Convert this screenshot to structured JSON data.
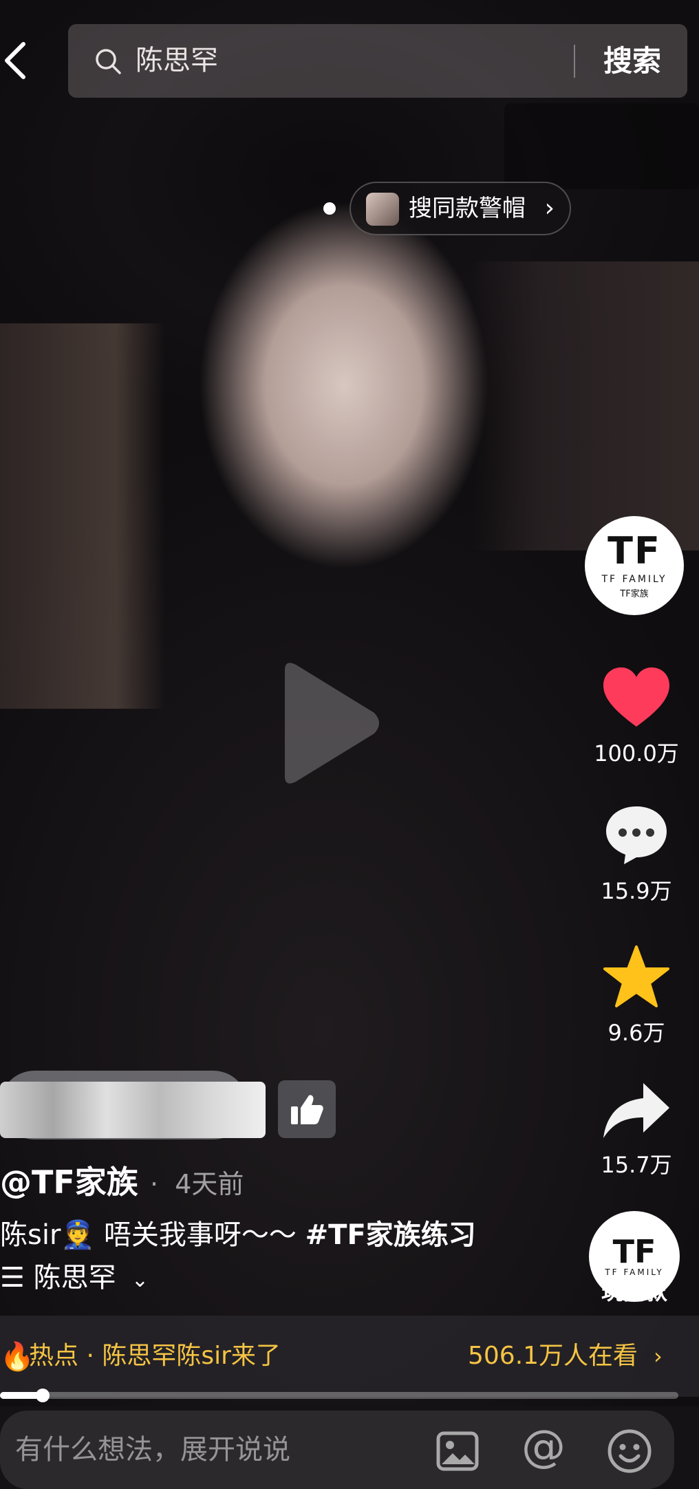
{
  "search": {
    "query": "陈思罕",
    "button_label": "搜索"
  },
  "same_item": {
    "label": "搜同款警帽"
  },
  "author": {
    "avatar_logo": "TF",
    "avatar_sub": "TF FAMILY",
    "avatar_sub2": "TF家族",
    "handle": "@TF家族",
    "time": "4天前"
  },
  "actions": {
    "likes": "100.0万",
    "comments": "15.9万",
    "favorites": "9.6万",
    "shares": "15.7万",
    "music_label": "玩同款"
  },
  "caption": {
    "prefix": "陈sir",
    "emoji": "👮",
    "text": "唔关我事呀～～",
    "hashtag": "#TF家族练习"
  },
  "music": {
    "title": "陈思罕"
  },
  "hot": {
    "label": "热点 · 陈思罕陈sir来了",
    "viewers": "506.1万人在看"
  },
  "progress": {
    "fraction": 0.063
  },
  "comment_input": {
    "placeholder": "有什么想法，展开说说"
  },
  "colors": {
    "like": "#ff3b5c",
    "favorite": "#ffc21a",
    "hot": "#f5c444"
  }
}
